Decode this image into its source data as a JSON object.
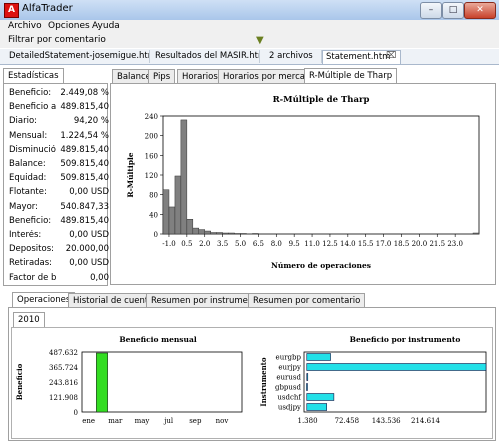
{
  "window": {
    "title": "AlfaTrader",
    "app_icon_glyph": "A"
  },
  "menu": {
    "items": [
      "Archivo",
      "Opciones",
      "Ayuda"
    ]
  },
  "filter": {
    "label": "Filtrar por comentario"
  },
  "doc_tabs": [
    {
      "label": "DetailedStatement-josemigue.htm"
    },
    {
      "label": "Resultados del MASIR.htm"
    },
    {
      "label": "2 archivos"
    },
    {
      "label": "Statement.htm",
      "active": true
    }
  ],
  "stats_tab": "Estadísticas",
  "stats": [
    {
      "label": "Beneficio:",
      "value": "2.449,08 %"
    },
    {
      "label": "Beneficio a",
      "value": "489.815,40"
    },
    {
      "label": "Diario:",
      "value": "94,20 %"
    },
    {
      "label": "Mensual:",
      "value": "1.224,54 %"
    },
    {
      "label": "Disminució",
      "value": "489.815,40"
    },
    {
      "label": "Balance:",
      "value": "509.815,40"
    },
    {
      "label": "Equidad:",
      "value": "509.815,40"
    },
    {
      "label": "Flotante:",
      "value": "0,00 USD"
    },
    {
      "label": "Mayor:",
      "value": "540.847,33"
    },
    {
      "label": "Beneficio:",
      "value": "489.815,40"
    },
    {
      "label": "Interés:",
      "value": "0,00 USD"
    },
    {
      "label": "Depositos:",
      "value": "20.000,00"
    },
    {
      "label": "Retiradas:",
      "value": "0,00 USD"
    },
    {
      "label": "Factor de b",
      "value": "0,00"
    }
  ],
  "chart_tabs": [
    "Balance",
    "Pips",
    "Horarios",
    "Horarios por mercado",
    "R-Múltiple de Tharp"
  ],
  "bottom_tabs": [
    "Operaciones",
    "Historial de cuentas",
    "Resumen por instrumento",
    "Resumen por comentario"
  ],
  "year_tab": "2010",
  "colors": {
    "hist_bar": "#808080",
    "monthly_bar": "#33dd22",
    "instrument_bar": "#22e0e8"
  },
  "chart_data": [
    {
      "type": "bar",
      "title": "R-Múltiple de Tharp",
      "xlabel": "Número de operaciones",
      "ylabel": "R-Múltiple",
      "ylim": [
        0,
        240
      ],
      "y_ticks": [
        "240",
        "200",
        "160",
        "120",
        "80",
        "40",
        "0"
      ],
      "x_ticks": [
        "-1.0",
        "0.5",
        "2.0",
        "3.5",
        "5.0",
        "6.5",
        "8.0",
        "9.5",
        "11.0",
        "12.5",
        "14.0",
        "15.5",
        "17.0",
        "18.5",
        "20.0",
        "21.5",
        "23.0"
      ],
      "x_range": [
        -1.5,
        25
      ],
      "bin_width": 0.5,
      "bins_x": [
        -1.5,
        -1.0,
        -0.5,
        0.0,
        0.5,
        1.0,
        1.5,
        2.0,
        2.5,
        3.0,
        3.5,
        4.0,
        4.5,
        5.0,
        6.0,
        24.5
      ],
      "values": [
        90,
        55,
        118,
        232,
        30,
        12,
        9,
        6,
        3,
        3,
        2,
        2,
        1,
        1,
        1,
        2
      ]
    },
    {
      "type": "bar",
      "title": "Beneficio mensual",
      "ylabel": "Beneficio",
      "categories": [
        "ene",
        "feb",
        "mar",
        "abr",
        "may",
        "jun",
        "jul",
        "ago",
        "sep",
        "oct",
        "nov",
        "dic"
      ],
      "x_ticks": [
        "ene",
        "mar",
        "may",
        "jul",
        "sep",
        "nov"
      ],
      "values": [
        0,
        489815,
        0,
        0,
        0,
        0,
        0,
        0,
        0,
        0,
        0,
        0
      ],
      "y_ticks": [
        "487.632",
        "365.724",
        "243.816",
        "121.908",
        "0"
      ],
      "ylim": [
        0,
        487632
      ]
    },
    {
      "type": "bar",
      "orientation": "horizontal",
      "title": "Beneficio por instrumento",
      "ylabel": "Instrumento",
      "categories": [
        "eurgbp",
        "eurjpy",
        "eurusd",
        "gbpusd",
        "usdchf",
        "usdjpy"
      ],
      "values": [
        43000,
        324000,
        500,
        -500,
        49000,
        36000
      ],
      "x_ticks": [
        "1.380",
        "72.458",
        "143.536",
        "214.614"
      ],
      "xlim": [
        -5000,
        324000
      ]
    }
  ]
}
